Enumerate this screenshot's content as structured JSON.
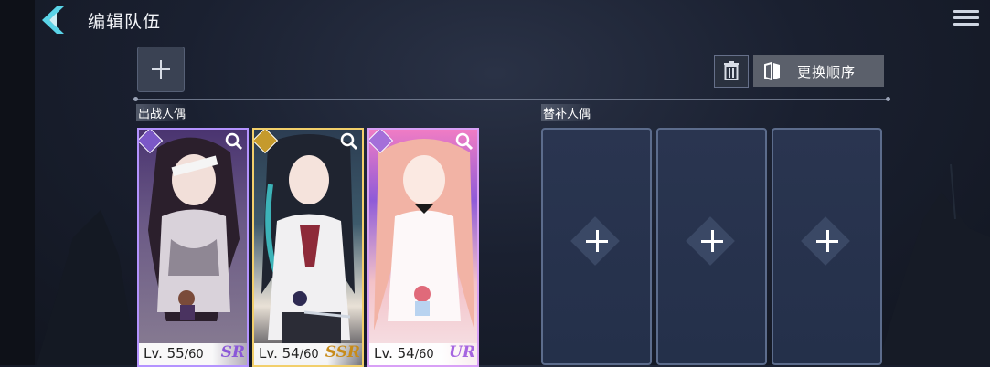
{
  "header": {
    "title": "编辑队伍",
    "back_icon": "chevron-left-icon",
    "menu_icon": "hamburger-menu-icon"
  },
  "toolbar": {
    "add_icon": "plus-icon",
    "delete_icon": "trash-icon",
    "reorder_label": "更换顺序",
    "reorder_icon": "book-icon"
  },
  "sections": {
    "active_label": "出战人偶",
    "reserve_label": "替补人偶"
  },
  "active_cards": [
    {
      "level": "Lv. 55",
      "max_level": "/60",
      "rarity": "SR",
      "color": "#b493ff"
    },
    {
      "level": "Lv. 54",
      "max_level": "/60",
      "rarity": "SSR",
      "color": "#f2cf6b"
    },
    {
      "level": "Lv. 54",
      "max_level": "/60",
      "rarity": "UR",
      "color": "#d8a0f6"
    }
  ],
  "reserve_slots": [
    {
      "icon": "plus-icon"
    },
    {
      "icon": "plus-icon"
    },
    {
      "icon": "plus-icon"
    }
  ]
}
